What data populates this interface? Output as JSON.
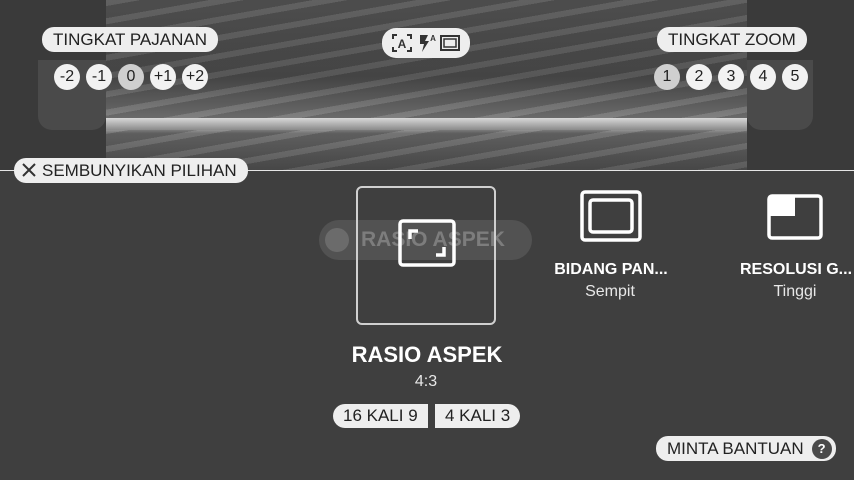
{
  "exposure": {
    "label": "TINGKAT PAJANAN",
    "levels": [
      "-2",
      "-1",
      "0",
      "+1",
      "+2"
    ],
    "selected": "0"
  },
  "zoom": {
    "label": "TINGKAT ZOOM",
    "levels": [
      "1",
      "2",
      "3",
      "4",
      "5"
    ],
    "selected": "1"
  },
  "mode_icons": [
    "auto-scene-icon",
    "flash-auto-icon",
    "aspect-frame-icon"
  ],
  "hide_options": {
    "label": "SEMBUNYIKAN PILIHAN",
    "icon": "close-icon"
  },
  "options": [
    {
      "title": "RASIO ASPEK",
      "value": "4:3",
      "icon": "aspect-ratio-icon",
      "selected": true
    },
    {
      "title": "BIDANG PAN...",
      "value": "Sempit",
      "icon": "field-of-view-icon",
      "selected": false
    },
    {
      "title": "RESOLUSI G...",
      "value": "Tinggi",
      "icon": "resolution-icon",
      "selected": false
    }
  ],
  "ghost_label": "RASIO ASPEK",
  "aspect_choices": [
    "16 KALI 9",
    "4 KALI 3"
  ],
  "help": {
    "label": "MINTA BANTUAN",
    "icon": "?"
  }
}
